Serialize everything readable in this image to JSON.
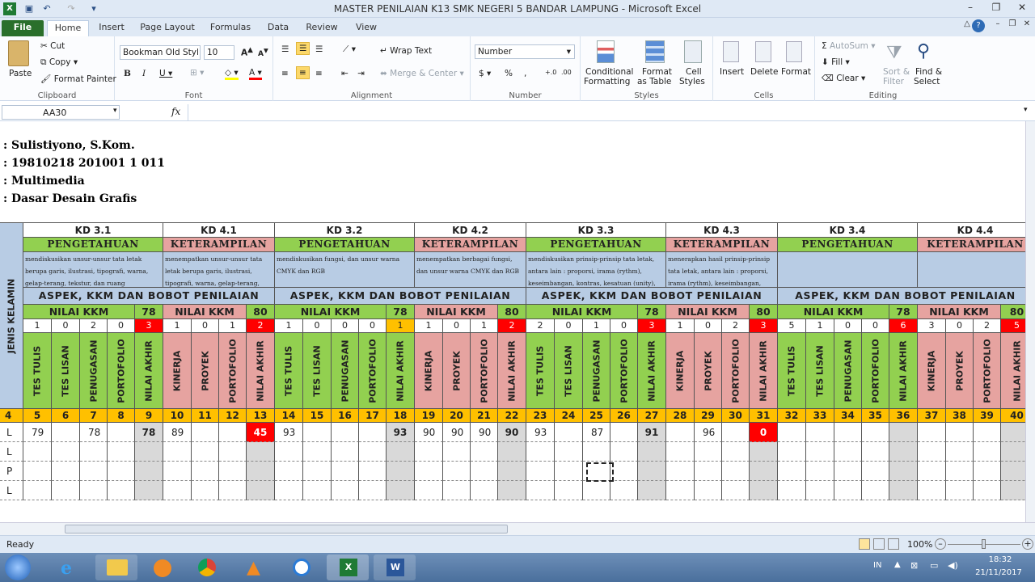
{
  "window": {
    "title": "MASTER PENILAIAN K13 SMK NEGERI 5 BANDAR LAMPUNG  -  Microsoft Excel"
  },
  "tabs": [
    "File",
    "Home",
    "Insert",
    "Page Layout",
    "Formulas",
    "Data",
    "Review",
    "View"
  ],
  "ribbon": {
    "clipboard": {
      "paste": "Paste",
      "cut": "Cut",
      "copy": "Copy",
      "format_painter": "Format Painter",
      "label": "Clipboard"
    },
    "font": {
      "name": "Bookman Old Styl",
      "size": "10",
      "label": "Font"
    },
    "alignment": {
      "wrap": "Wrap Text",
      "merge": "Merge & Center",
      "label": "Alignment"
    },
    "number": {
      "format": "Number",
      "label": "Number"
    },
    "styles": {
      "cond": "Conditional",
      "cond2": "Formatting",
      "fmt": "Format",
      "fmt2": "as Table",
      "cell": "Cell",
      "cell2": "Styles",
      "label": "Styles"
    },
    "cells": {
      "insert": "Insert",
      "delete": "Delete",
      "format": "Format",
      "label": "Cells"
    },
    "editing": {
      "autosum": "AutoSum",
      "fill": "Fill",
      "clear": "Clear",
      "sort": "Sort &",
      "sort2": "Filter",
      "find": "Find &",
      "find2": "Select",
      "label": "Editing"
    }
  },
  "formula_bar": {
    "name_box": "AA30",
    "fx": "fx",
    "value": ""
  },
  "header_info": [
    ": Sulistiyono, S.Kom.",
    ": 19810218 201001 1 011",
    ": Multimedia",
    ": Dasar Desain Grafis"
  ],
  "jenis_kelamin": "JENIS KELAMIN",
  "blocks": [
    {
      "kd": "KD 3.1",
      "type": "PENGETAHUAN",
      "desc": "mendiskusikan unsur-unsur tata letak berupa garis, ilustrasi, tipografi, warna, gelap-terang, tekstur, dan ruang",
      "kkm": "78",
      "weights": [
        "1",
        "0",
        "2",
        "0",
        "3"
      ],
      "cols": [
        "TES TULIS",
        "TES LISAN",
        "PENUGASAN",
        "PORTOFOLIO",
        "NILAI AKHIR"
      ],
      "nums": [
        "5",
        "6",
        "7",
        "8",
        "9"
      ],
      "vals": [
        "79",
        "",
        "78",
        "",
        "78"
      ]
    },
    {
      "kd": "KD 4.1",
      "type": "KETERAMPILAN",
      "desc": "menempatkan unsur-unsur tata letak berupa garis, ilustrasi, tipografi, warna, gelap-terang, tekstur, dan ruang",
      "kkm": "80",
      "weights": [
        "1",
        "0",
        "1",
        "2"
      ],
      "cols": [
        "KINERJA",
        "PROYEK",
        "PORTOFOLIO",
        "NILAI AKHIR"
      ],
      "nums": [
        "10",
        "11",
        "12",
        "13"
      ],
      "vals": [
        "89",
        "",
        "",
        "45"
      ]
    },
    {
      "kd": "KD 3.2",
      "type": "PENGETAHUAN",
      "desc": "mendiskusikan fungsi, dan unsur warna CMYK dan RGB",
      "kkm": "78",
      "weights": [
        "1",
        "0",
        "0",
        "0",
        "1"
      ],
      "cols": [
        "TES TULIS",
        "TES LISAN",
        "PENUGASAN",
        "PORTOFOLIO",
        "NILAI AKHIR"
      ],
      "nums": [
        "14",
        "15",
        "16",
        "17",
        "18"
      ],
      "vals": [
        "93",
        "",
        "",
        "",
        "93"
      ]
    },
    {
      "kd": "KD 4.2",
      "type": "KETERAMPILAN",
      "desc": "menempatkan berbagai fungsi, dan unsur warna CMYK dan RGB",
      "kkm": "80",
      "weights": [
        "1",
        "0",
        "1",
        "2"
      ],
      "cols": [
        "KINERJA",
        "PROYEK",
        "PORTOFOLIO",
        "NILAI AKHIR"
      ],
      "nums": [
        "19",
        "20",
        "21",
        "22"
      ],
      "vals": [
        "90",
        "90",
        "90",
        "90"
      ]
    },
    {
      "kd": "KD 3.3",
      "type": "PENGETAHUAN",
      "desc": "mendiskusikan prinsip-prinsip tata letak, antara lain : proporsi, irama (rythm), keseimbangan, kontras, kesatuan (unity), dan harmoni dalam pembuatan desain grafis",
      "kkm": "78",
      "weights": [
        "2",
        "0",
        "1",
        "0",
        "3"
      ],
      "cols": [
        "TES TULIS",
        "TES LISAN",
        "PENUGASAN",
        "PORTOFOLIO",
        "NILAI AKHIR"
      ],
      "nums": [
        "23",
        "24",
        "25",
        "26",
        "27"
      ],
      "vals": [
        "93",
        "",
        "87",
        "",
        "91"
      ]
    },
    {
      "kd": "KD 4.3",
      "type": "KETERAMPILAN",
      "desc": "menerapkan hasil prinsip-prinsip tata letak, antara lain : proporsi, irama (rythm), keseimbangan, kontras, kesatuan (unity), dan harmoni",
      "kkm": "80",
      "weights": [
        "1",
        "0",
        "2",
        "3"
      ],
      "cols": [
        "KINERJA",
        "PROYEK",
        "PORTOFOLIO",
        "NILAI AKHIR"
      ],
      "nums": [
        "28",
        "29",
        "30",
        "31"
      ],
      "vals": [
        "",
        "96",
        "",
        "0"
      ]
    },
    {
      "kd": "KD 3.4",
      "type": "PENGETAHUAN",
      "desc": "",
      "kkm": "78",
      "weights": [
        "5",
        "1",
        "0",
        "0",
        "6"
      ],
      "cols": [
        "TES TULIS",
        "TES LISAN",
        "PENUGASAN",
        "PORTOFOLIO",
        "NILAI AKHIR"
      ],
      "nums": [
        "32",
        "33",
        "34",
        "35",
        "36"
      ],
      "vals": [
        "",
        "",
        "",
        "",
        ""
      ]
    },
    {
      "kd": "KD 4.4",
      "type": "KETERAMPILAN",
      "desc": "",
      "kkm": "80",
      "weights": [
        "3",
        "0",
        "2",
        "5"
      ],
      "cols": [
        "KINERJA",
        "PROYEK",
        "PORTOFOLIO",
        "NILAI AKHIR"
      ],
      "nums": [
        "37",
        "38",
        "39",
        "40"
      ],
      "vals": [
        "",
        "",
        "",
        ""
      ]
    }
  ],
  "aspek": "ASPEK, KKM DAN BOBOT PENILAIAN",
  "nilai_kkm": "NILAI KKM",
  "col4": "4",
  "rows": [
    "L",
    "L",
    "P",
    "L"
  ],
  "status": {
    "ready": "Ready",
    "zoom": "100%"
  },
  "tray": {
    "lang": "IN",
    "time": "18:32",
    "date": "21/11/2017"
  }
}
